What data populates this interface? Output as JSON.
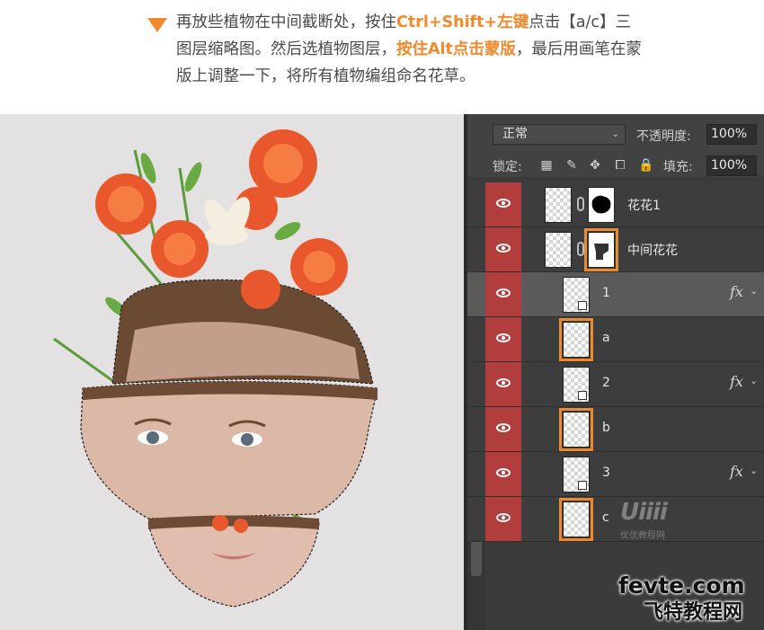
{
  "instruction": {
    "p1": "再放些植物在中间截断处，按住",
    "h1": "Ctrl+Shift+左键",
    "p2": "点击【a/c】三图层缩略图。然后选植物图层，",
    "h2": "按住Alt点击蒙版",
    "p3": "，最后用画笔在蒙版上调整一下，将所有植物编组命名花草。"
  },
  "options": {
    "blend_mode": "正常",
    "opacity_label": "不透明度:",
    "opacity_value": "100%",
    "lock_label": "锁定:",
    "fill_label": "填充:",
    "fill_value": "100%"
  },
  "layers": [
    {
      "name": "花花1",
      "mask": true,
      "boxed": false,
      "fx": false
    },
    {
      "name": "中间花花",
      "mask": true,
      "boxed": true,
      "fx": false
    },
    {
      "name": "1",
      "mask": false,
      "boxed": false,
      "fx": true
    },
    {
      "name": "a",
      "mask": false,
      "boxed": true,
      "fx": false
    },
    {
      "name": "2",
      "mask": false,
      "boxed": false,
      "fx": true
    },
    {
      "name": "b",
      "mask": false,
      "boxed": true,
      "fx": false
    },
    {
      "name": "3",
      "mask": false,
      "boxed": false,
      "fx": true
    },
    {
      "name": "c",
      "mask": false,
      "boxed": true,
      "fx": false
    }
  ],
  "fx_label": "fx",
  "watermarks": {
    "uiiii": "Uiiii",
    "uiiii_sub": "优优教程网",
    "fevte": "fevte.com",
    "fevte_cn": "飞特教程网"
  },
  "colors": {
    "accent": "#f08a2c",
    "eye_bg": "#b23d3d",
    "panel_bg": "#3b3b3b"
  }
}
